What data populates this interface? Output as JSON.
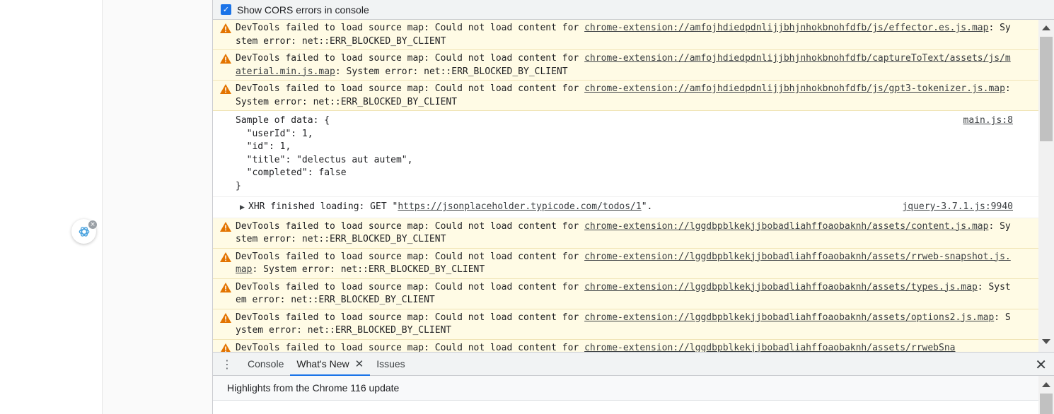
{
  "settings": {
    "cors_label": "Show CORS errors in console",
    "cors_checked": true
  },
  "console": {
    "warnings_top": [
      {
        "prefix": "DevTools failed to load source map: Could not load content for ",
        "url": "chrome-extension://amfojhdiedpdnlijjbhjnhokbnohfdfb/js/effector.es.js.map",
        "suffix": ": System error: net::ERR_BLOCKED_BY_CLIENT"
      },
      {
        "prefix": "DevTools failed to load source map: Could not load content for ",
        "url": "chrome-extension://amfojhdiedpdnlijjbhjnhokbnohfdfb/captureToText/assets/js/material.min.js.map",
        "suffix": ": System error: net::ERR_BLOCKED_BY_CLIENT"
      },
      {
        "prefix": "DevTools failed to load source map: Could not load content for ",
        "url": "chrome-extension://amfojhdiedpdnlijjbhjnhokbnohfdfb/js/gpt3-tokenizer.js.map",
        "suffix": ": System error: net::ERR_BLOCKED_BY_CLIENT"
      }
    ],
    "log": {
      "text": "Sample of data: {\n  \"userId\": 1,\n  \"id\": 1,\n  \"title\": \"delectus aut autem\",\n  \"completed\": false\n}",
      "source": "main.js:8"
    },
    "xhr": {
      "prefix": "XHR finished loading: GET \"",
      "url": "https://jsonplaceholder.typicode.com/todos/1",
      "suffix": "\".",
      "source": "jquery-3.7.1.js:9940"
    },
    "warnings_bottom": [
      {
        "prefix": "DevTools failed to load source map: Could not load content for ",
        "url": "chrome-extension://lggdbpblkekjjbobadliahffoaobaknh/assets/content.js.map",
        "suffix": ": System error: net::ERR_BLOCKED_BY_CLIENT"
      },
      {
        "prefix": "DevTools failed to load source map: Could not load content for ",
        "url": "chrome-extension://lggdbpblkekjjbobadliahffoaobaknh/assets/rrweb-snapshot.js.map",
        "suffix": ": System error: net::ERR_BLOCKED_BY_CLIENT"
      },
      {
        "prefix": "DevTools failed to load source map: Could not load content for ",
        "url": "chrome-extension://lggdbpblkekjjbobadliahffoaobaknh/assets/types.js.map",
        "suffix": ": System error: net::ERR_BLOCKED_BY_CLIENT"
      },
      {
        "prefix": "DevTools failed to load source map: Could not load content for ",
        "url": "chrome-extension://lggdbpblkekjjbobadliahffoaobaknh/assets/options2.js.map",
        "suffix": ": System error: net::ERR_BLOCKED_BY_CLIENT"
      },
      {
        "prefix": "DevTools failed to load source map: Could not load content for ",
        "url": "chrome-extension://lggdbpblkekjjbobadliahffoaobaknh/assets/rrwebSna",
        "suffix": ""
      }
    ]
  },
  "drawer": {
    "tabs": [
      {
        "label": "Console"
      },
      {
        "label": "What's New"
      },
      {
        "label": "Issues"
      }
    ],
    "whats_new_header": "Highlights from the Chrome 116 update"
  },
  "colors": {
    "accent": "#1a73e8",
    "warning_bg": "#fffbe5",
    "warning_icon": "#e37400"
  },
  "icons": {
    "warning": "warning-triangle-icon",
    "kebab": "more-vert-icon",
    "close": "close-icon",
    "extension": "openai-logo-icon"
  }
}
